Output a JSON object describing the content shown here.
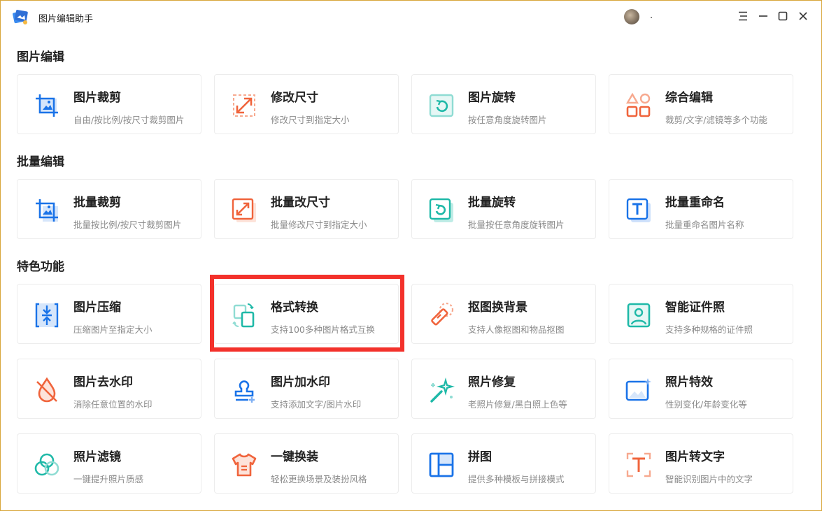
{
  "app": {
    "title": "图片编辑助手",
    "username": "."
  },
  "window_controls": {
    "menu_icon": "menu-icon",
    "minimize_icon": "minimize-icon",
    "maximize_icon": "maximize-icon",
    "close_icon": "close-icon"
  },
  "sections": [
    {
      "title": "图片编辑",
      "items": [
        {
          "title": "图片裁剪",
          "desc": "自由/按比例/按尺寸裁剪图片",
          "icon": "crop-icon"
        },
        {
          "title": "修改尺寸",
          "desc": "修改尺寸到指定大小",
          "icon": "resize-icon"
        },
        {
          "title": "图片旋转",
          "desc": "按任意角度旋转图片",
          "icon": "rotate-icon"
        },
        {
          "title": "综合编辑",
          "desc": "裁剪/文字/滤镜等多个功能",
          "icon": "shapes-icon"
        }
      ]
    },
    {
      "title": "批量编辑",
      "items": [
        {
          "title": "批量裁剪",
          "desc": "批量按比例/按尺寸裁剪图片",
          "icon": "batch-crop-icon"
        },
        {
          "title": "批量改尺寸",
          "desc": "批量修改尺寸到指定大小",
          "icon": "batch-resize-icon"
        },
        {
          "title": "批量旋转",
          "desc": "批量按任意角度旋转图片",
          "icon": "batch-rotate-icon"
        },
        {
          "title": "批量重命名",
          "desc": "批量重命名图片名称",
          "icon": "batch-rename-icon"
        }
      ]
    },
    {
      "title": "特色功能",
      "items": [
        {
          "title": "图片压缩",
          "desc": "压缩图片至指定大小",
          "icon": "compress-icon"
        },
        {
          "title": "格式转换",
          "desc": "支持100多种图片格式互换",
          "icon": "format-convert-icon"
        },
        {
          "title": "抠图换背景",
          "desc": "支持人像抠图和物品抠图",
          "icon": "cutout-icon"
        },
        {
          "title": "智能证件照",
          "desc": "支持多种规格的证件照",
          "icon": "id-photo-icon"
        },
        {
          "title": "图片去水印",
          "desc": "消除任意位置的水印",
          "icon": "remove-watermark-icon"
        },
        {
          "title": "图片加水印",
          "desc": "支持添加文字/图片水印",
          "icon": "add-watermark-icon"
        },
        {
          "title": "照片修复",
          "desc": "老照片修复/黑白照上色等",
          "icon": "magic-wand-icon"
        },
        {
          "title": "照片特效",
          "desc": "性别变化/年龄变化等",
          "icon": "photo-effect-icon"
        },
        {
          "title": "照片滤镜",
          "desc": "一键提升照片质感",
          "icon": "filter-icon"
        },
        {
          "title": "一键换装",
          "desc": "轻松更换场景及装扮风格",
          "icon": "clothes-icon"
        },
        {
          "title": "拼图",
          "desc": "提供多种模板与拼接模式",
          "icon": "collage-icon"
        },
        {
          "title": "图片转文字",
          "desc": "智能识别图片中的文字",
          "icon": "ocr-icon"
        }
      ]
    }
  ],
  "colors": {
    "blue": "#1a73e8",
    "orange": "#f0643c",
    "teal": "#1fb9a8",
    "highlight": "#f3312b"
  }
}
